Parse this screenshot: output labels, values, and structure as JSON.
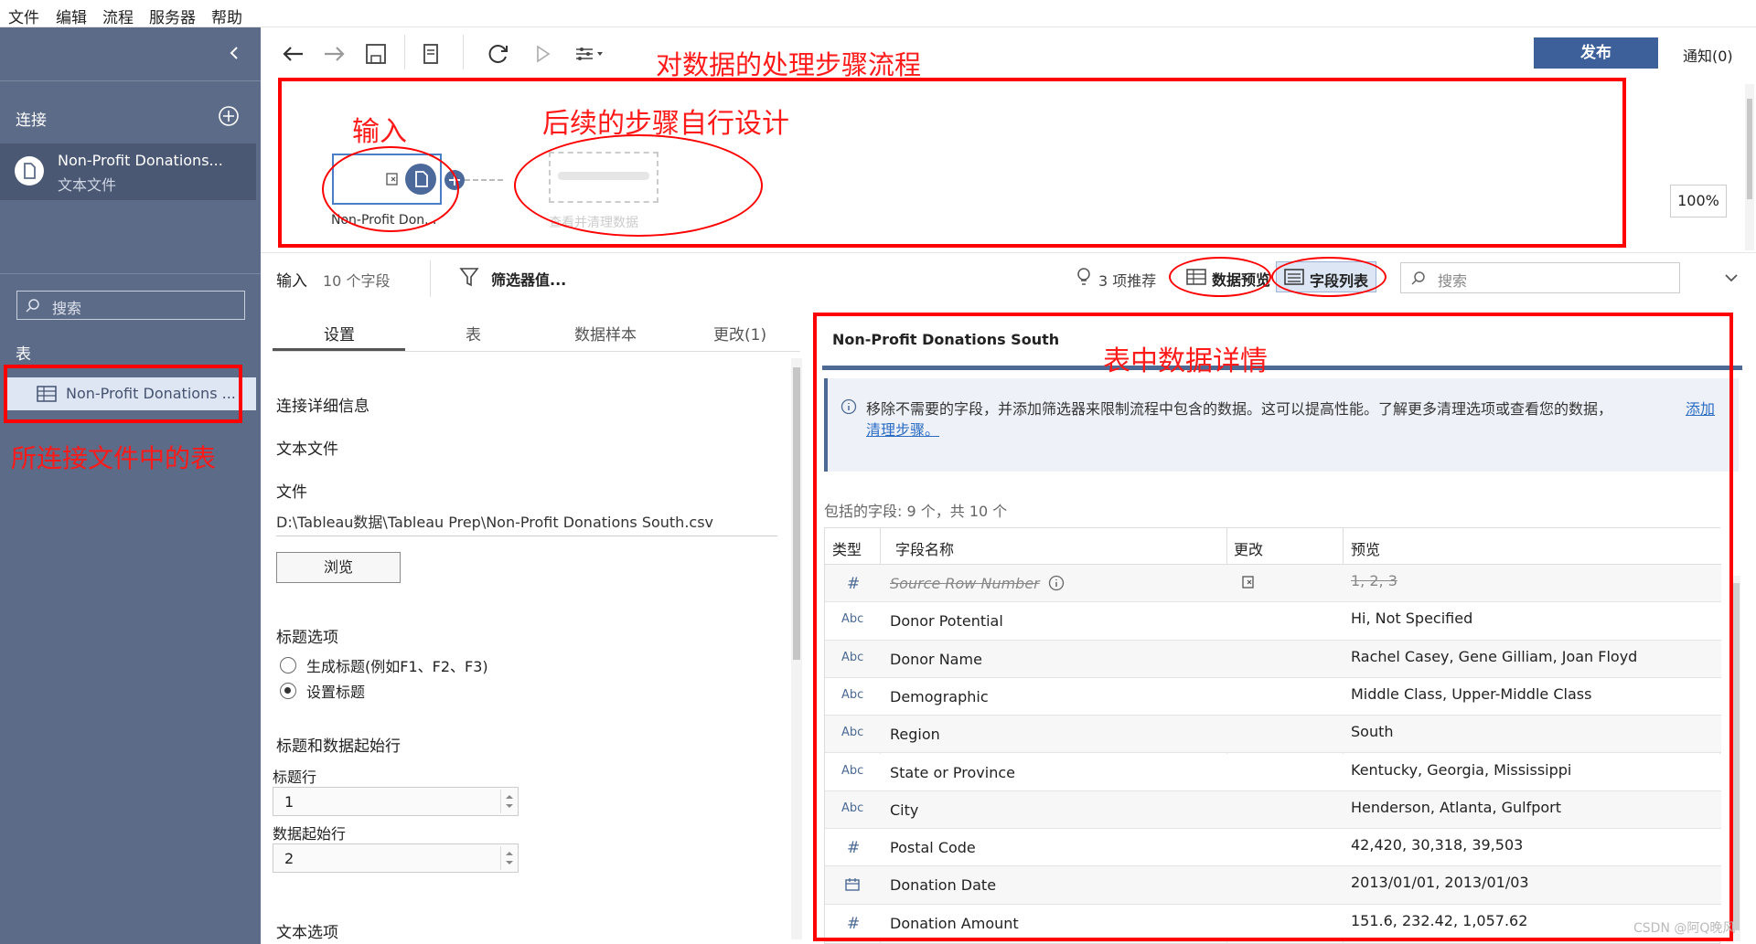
{
  "menu": [
    "文件",
    "编辑",
    "流程",
    "服务器",
    "帮助"
  ],
  "sidebar": {
    "connections_label": "连接",
    "connection": {
      "name": "Non-Profit Donations...",
      "type": "文本文件"
    },
    "search_placeholder": "搜索",
    "tables_label": "表",
    "table_item": "Non-Profit Donations ..."
  },
  "toolbar": {
    "publish": "发布",
    "notify": "通知(0)"
  },
  "canvas": {
    "input_node_label": "Non-Profit Don...",
    "ghost_node_label": "查看并清理数据",
    "zoom": "100%"
  },
  "annotations": {
    "flow": "对数据的处理步骤流程",
    "input": "输入",
    "followup": "后续的步骤自行设计",
    "table_in_file": "所连接文件中的表",
    "table_detail": "表中数据详情"
  },
  "input_bar": {
    "input_label": "输入",
    "field_count": "10 个字段",
    "filter": "筛选器值...",
    "recommend": "3 项推荐",
    "data_preview": "数据预览",
    "field_list": "字段列表",
    "search_placeholder": "搜索"
  },
  "settings_tabs": [
    "设置",
    "表",
    "数据样本",
    "更改(1)"
  ],
  "settings": {
    "conn_details": "连接详细信息",
    "text_file": "文本文件",
    "file_label": "文件",
    "file_path": "D:\\Tableau数据\\Tableau Prep\\Non-Profit Donations South.csv",
    "browse": "浏览",
    "header_options": "标题选项",
    "gen_header": "生成标题(例如F1、F2、F3)",
    "set_header": "设置标题",
    "header_start": "标题和数据起始行",
    "header_row_label": "标题行",
    "header_row_value": "1",
    "data_start_label": "数据起始行",
    "data_start_value": "2",
    "text_options": "文本选项"
  },
  "detail": {
    "title": "Non-Profit Donations South",
    "info": "移除不需要的字段，并添加筛选器来限制流程中包含的数据。这可以提高性能。了解更多清理选项或查看您的数据，",
    "info_link1": "添加",
    "info_link2": "清理步骤。",
    "included": "包括的字段: 9 个，共 10 个",
    "columns": [
      "类型",
      "字段名称",
      "更改",
      "预览"
    ],
    "rows": [
      {
        "type": "#",
        "name": "Source Row Number",
        "preview": "1, 2, 3",
        "removed": true
      },
      {
        "type": "Abc",
        "name": "Donor Potential",
        "preview": "Hi, Not Specified"
      },
      {
        "type": "Abc",
        "name": "Donor Name",
        "preview": "Rachel Casey, Gene Gilliam, Joan Floyd"
      },
      {
        "type": "Abc",
        "name": "Demographic",
        "preview": "Middle Class, Upper-Middle Class"
      },
      {
        "type": "Abc",
        "name": "Region",
        "preview": "South"
      },
      {
        "type": "Abc",
        "name": "State or Province",
        "preview": "Kentucky, Georgia, Mississippi"
      },
      {
        "type": "Abc",
        "name": "City",
        "preview": "Henderson, Atlanta, Gulfport"
      },
      {
        "type": "#",
        "name": "Postal Code",
        "preview": "42,420, 30,318, 39,503"
      },
      {
        "type": "date",
        "name": "Donation Date",
        "preview": "2013/01/01, 2013/01/03"
      },
      {
        "type": "#",
        "name": "Donation Amount",
        "preview": "151.6, 232.42, 1,057.62"
      }
    ]
  },
  "watermark": "CSDN @阿Q晚风"
}
